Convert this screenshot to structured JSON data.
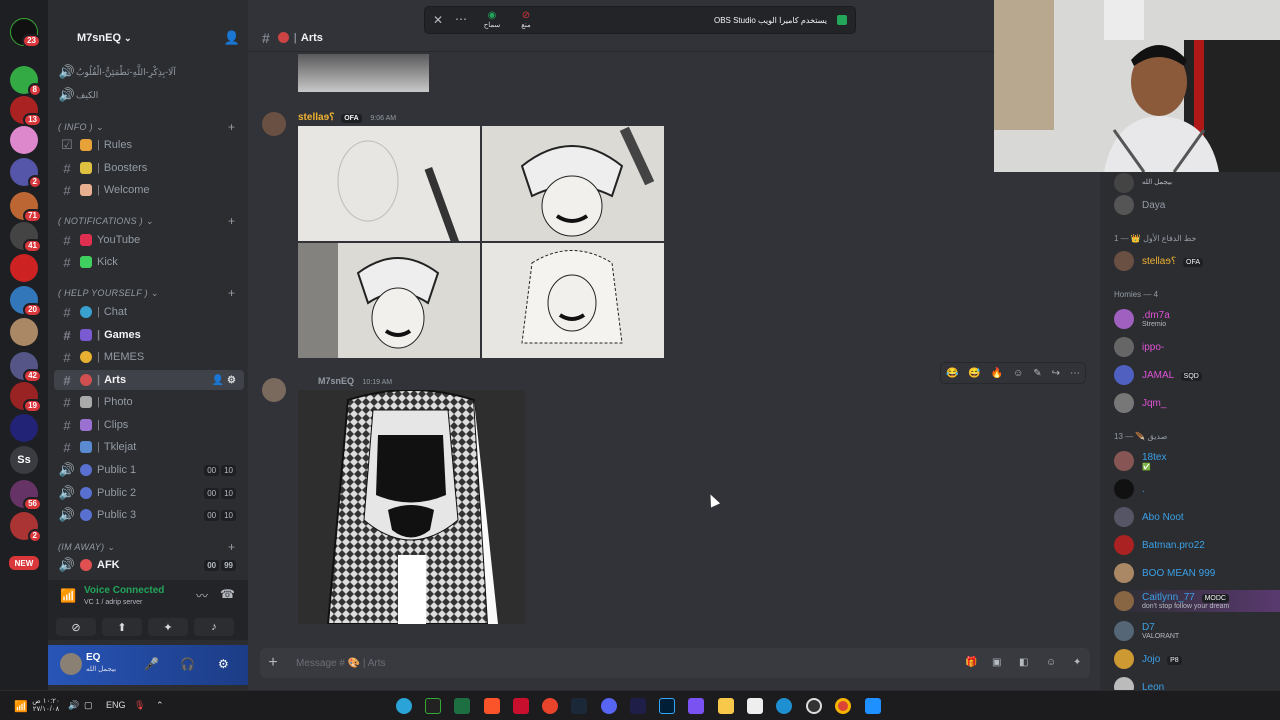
{
  "server": {
    "name": "M7snEQ"
  },
  "rail_badges": [
    "23",
    "8",
    "13",
    "",
    "",
    "2",
    "71",
    "41",
    "",
    "",
    "20",
    "",
    "42",
    "19",
    "",
    "",
    "56",
    "2"
  ],
  "rail_new": "NEW",
  "rail_label": "Ss",
  "channels": [
    {
      "name": "آلَا-بِذِكْرِ-اللَّهِ-تَطْمَئِنُّ-الْقُلُوبُ",
      "type": "voice"
    },
    {
      "name": "الكيف",
      "type": "voice"
    }
  ],
  "categories": {
    "info": "( INFO )",
    "notifications": "( NOTIFICATIONS )",
    "help": "( HELP YOURSELF )",
    "away": "(IM AWAY)"
  },
  "info_channels": [
    "Rules",
    "Boosters",
    "Welcome"
  ],
  "notif_channels": [
    "YouTube",
    "Kick"
  ],
  "help_channels": [
    "Chat",
    "Games",
    "MEMES",
    "Arts",
    "Photo",
    "Clips",
    "Tklejat"
  ],
  "voice_channels": [
    {
      "name": "Public 1",
      "a": "00",
      "b": "10"
    },
    {
      "name": "Public 2",
      "a": "00",
      "b": "10"
    },
    {
      "name": "Public 3",
      "a": "00",
      "b": "10"
    },
    {
      "name": "AFK",
      "a": "00",
      "b": "99"
    }
  ],
  "voice_status": {
    "title": "Voice Connected",
    "sub": "VC 1 / adrip server"
  },
  "user": {
    "name": "EQ",
    "status": "بيجمل الله"
  },
  "topbar": {
    "channel": "Arts"
  },
  "obs": {
    "text": "OBS Studio يستخدم كاميرا الويب",
    "allow": "سماح",
    "deny": "منع"
  },
  "messages": [
    {
      "author": "stellaɘ؟",
      "tag": "OFA",
      "time": "9:06 AM"
    },
    {
      "author": "M7snEQ",
      "time": "10:19 AM"
    }
  ],
  "composer": {
    "placeholder": "Message #",
    "channel": "Arts"
  },
  "members": {
    "top_status": "بيجمل الله",
    "daya": "Daya",
    "section1": "خط الدفاع الأول 👑 — 1",
    "stella": "stellaɘ؟",
    "stella_tag": "OFA",
    "section2": "Homies — 4",
    "homies": [
      {
        "name": ".dm7a",
        "status": "Stremio",
        "color": "#e052d6"
      },
      {
        "name": "ippo-",
        "status": "",
        "color": "#e052d6"
      },
      {
        "name": "JAMAL",
        "status": "",
        "tag": "SQD",
        "color": "#e052d6"
      },
      {
        "name": "Jqm_",
        "status": "",
        "color": "#e052d6"
      }
    ],
    "section3": "صديق 🪶 — 13",
    "friends": [
      {
        "name": "18tex",
        "status": "✅"
      },
      {
        "name": ".",
        "status": ""
      },
      {
        "name": "Abo Noot",
        "status": ""
      },
      {
        "name": "Batman.pro22",
        "status": ""
      },
      {
        "name": "BOO MEAN 999",
        "status": ""
      },
      {
        "name": "Caitlynn_77",
        "status": "don't stop follow your dream",
        "tag": "MODC"
      },
      {
        "name": "D7",
        "status": "VALORANT"
      },
      {
        "name": "Jojo",
        "status": "",
        "tag": "P8"
      },
      {
        "name": "Leon",
        "status": ""
      }
    ]
  },
  "taskbar": {
    "time": "١٠:٢٠ ص",
    "date": "٢٧/١٠/٠٨",
    "lang": "ENG"
  },
  "colors": {
    "bg": "#313338",
    "sidebar": "#2b2d31",
    "accent": "#5865f2",
    "online": "#23a55a",
    "stella": "#f0b232",
    "homies": "#e052d6",
    "friends": "#3ba0e6"
  }
}
